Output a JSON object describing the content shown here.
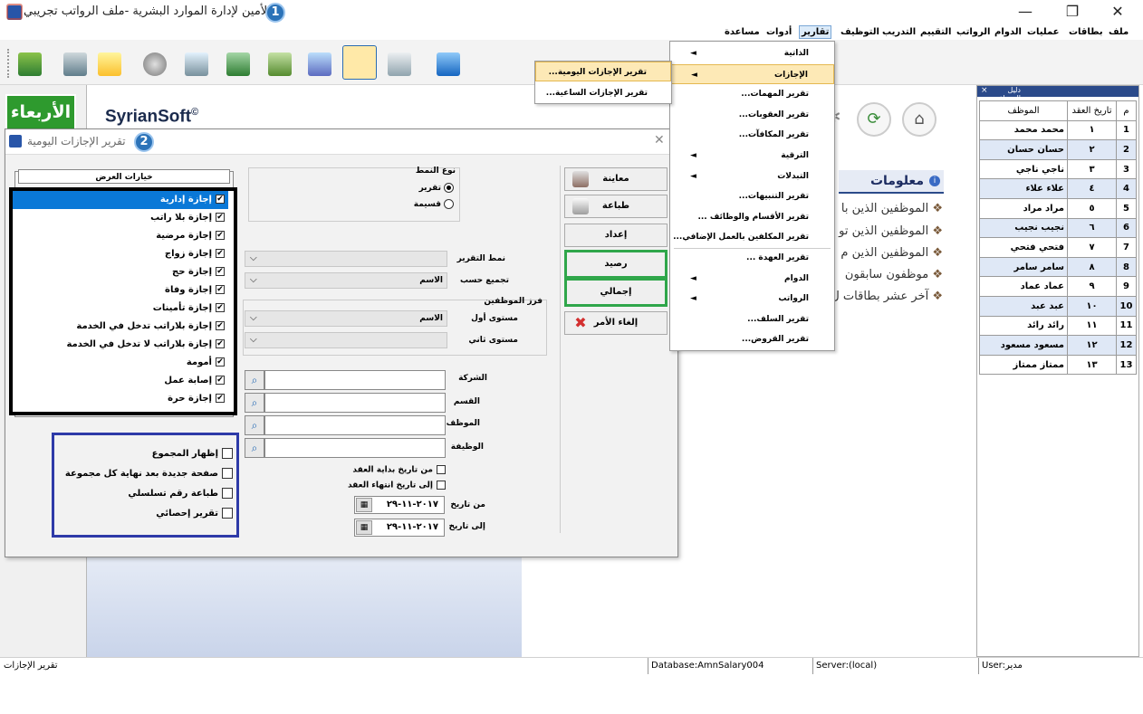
{
  "window": {
    "title": "الأمين لإدارة الموارد البشرية -ملف الرواتب تجريبي",
    "badge1": "1",
    "minimize": "—",
    "maximize": "❐",
    "close": "✕"
  },
  "menubar": [
    "ملف",
    "بطاقات",
    "عمليات",
    "الدوام",
    "الرواتب",
    "التقييم",
    "التدريب",
    "التوظيف",
    "تقارير",
    "أدوات",
    "مساعدة"
  ],
  "reports_menu": {
    "items": [
      {
        "label": "الذاتية",
        "submenu": true
      },
      {
        "label": "الإجازات",
        "submenu": true,
        "highlighted": true
      },
      {
        "label": "تقرير المهمات...",
        "submenu": false
      },
      {
        "label": "تقرير العقوبات...",
        "submenu": false
      },
      {
        "label": "تقرير المكافآت...",
        "submenu": false
      },
      {
        "label": "الترقية",
        "submenu": true
      },
      {
        "label": "التبدلات",
        "submenu": true
      },
      {
        "label": "تقرير التنبيهات...",
        "submenu": false
      },
      {
        "label": "تقرير الأقسام والوظائف ...",
        "submenu": false
      },
      {
        "label": "تقرير المكلفين بالعمل الإضافي...",
        "submenu": false
      },
      {
        "label": "تقرير العهدة ...",
        "submenu": false
      },
      {
        "label": "الدوام",
        "submenu": true
      },
      {
        "label": "الرواتب",
        "submenu": true
      },
      {
        "label": "تقرير السلف...",
        "submenu": false
      },
      {
        "label": "تقرير القروض...",
        "submenu": false
      }
    ],
    "arrow": "◄"
  },
  "leave_submenu": {
    "items": [
      "تقرير الإجازات اليومية...",
      "تقرير الإجازات الساعية..."
    ]
  },
  "left_panel": {
    "day": "الأربعاء"
  },
  "brand": {
    "name": "SyrianSoft",
    "mark": "©"
  },
  "info": {
    "title": "معلومات",
    "icon": "i",
    "lines": [
      "الموظفين الذين با",
      "الموظفين الذين تو",
      "الموظفين الذين م",
      "موظفون سابقون",
      "آخر عشر بطاقات ل"
    ]
  },
  "employee_panel": {
    "title": "دليل الموظفين",
    "close": "×",
    "headers": [
      "م",
      "تاريخ العقد",
      "الموظف"
    ],
    "rows": [
      [
        "1",
        "١",
        "محمد محمد"
      ],
      [
        "2",
        "٢",
        "حسان حسان"
      ],
      [
        "3",
        "٣",
        "ناجي ناجي"
      ],
      [
        "4",
        "٤",
        "علاء علاء"
      ],
      [
        "5",
        "٥",
        "مراد مراد"
      ],
      [
        "6",
        "٦",
        "نجيب نجيب"
      ],
      [
        "7",
        "٧",
        "فتحي فتحي"
      ],
      [
        "8",
        "٨",
        "سامر سامر"
      ],
      [
        "9",
        "٩",
        "عماد عماد"
      ],
      [
        "10",
        "١٠",
        "عبد عبد"
      ],
      [
        "11",
        "١١",
        "رائد رائد"
      ],
      [
        "12",
        "١٢",
        "مسعود مسعود"
      ],
      [
        "13",
        "١٣",
        "ممتاز ممتاز"
      ]
    ]
  },
  "dialog": {
    "title": "تقرير الإجازات اليومية",
    "badge2": "2",
    "close": "✕",
    "view_options_label": "خيارات العرض",
    "leave_types": [
      {
        "label": "إجازة إدارية",
        "checked": true,
        "selected": true
      },
      {
        "label": "إجازة بلا راتب",
        "checked": true
      },
      {
        "label": "إجازة مرضية",
        "checked": true
      },
      {
        "label": "إجازة زواج",
        "checked": true
      },
      {
        "label": "إجازة حج",
        "checked": true
      },
      {
        "label": "إجازة وفاة",
        "checked": true
      },
      {
        "label": "إجازة تأمينات",
        "checked": true
      },
      {
        "label": "إجازة بلاراتب تدخل في الخدمة",
        "checked": true
      },
      {
        "label": "إجازة بلاراتب لا تدخل في الخدمة",
        "checked": true
      },
      {
        "label": "أمومة",
        "checked": true
      },
      {
        "label": "إصابة عمل",
        "checked": true
      },
      {
        "label": "إجازة حرة",
        "checked": true
      }
    ],
    "extra_options": [
      {
        "label": "إظهار المجموع",
        "checked": false
      },
      {
        "label": "صفحة جديدة بعد نهاية كل مجموعة",
        "checked": false
      },
      {
        "label": "طباعة رقم تسلسلي",
        "checked": false
      },
      {
        "label": "تقرير إحصائي",
        "checked": false
      }
    ],
    "pattern_type": {
      "label": "نوع النمط",
      "options": [
        {
          "label": "تقرير",
          "selected": true
        },
        {
          "label": "قسيمة",
          "selected": false
        }
      ]
    },
    "report_pattern_label": "نمط التقرير",
    "group_by_label": "تجميع حسب",
    "group_by_value": "الاسم",
    "sort_group_label": "فرز الموظفين",
    "level1_label": "مستوى أول",
    "level1_value": "الاسم",
    "level2_label": "مستوى ثاني",
    "company_label": "الشركة",
    "department_label": "القسم",
    "employee_label": "الموظف",
    "job_label": "الوظيفة",
    "from_contract_start": "من تاريخ بداية العقد",
    "to_contract_end": "إلى تاريخ انتهاء العقد",
    "from_date_label": "من تاريخ",
    "from_date_value": "٢٠١٧-١١-٢٩",
    "to_date_label": "إلى تاريخ",
    "to_date_value": "٢٠١٧-١١-٢٩",
    "buttons": {
      "preview": "معاينة",
      "print": "طباعة",
      "setup": "إعداد",
      "balance": "رصيد",
      "total": "إجمالي",
      "cancel": "إلغاء الأمر"
    }
  },
  "statusbar": {
    "left": "تقرير الإجازات",
    "database": "Database:AmnSalary004",
    "server": "Server:(local)",
    "user": "User:مدير"
  },
  "colors": {
    "selection": "#0a78d7",
    "highlight": "#fde9b6",
    "green_box": "#2fa64a",
    "blue_box": "#2e3aa8",
    "badge": "#2c73b8",
    "day_tile": "#2e9a2e"
  }
}
